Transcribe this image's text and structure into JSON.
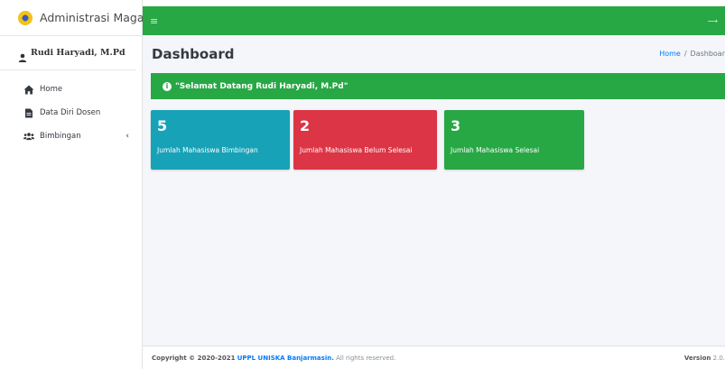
{
  "brand": {
    "title": "Administrasi Magang"
  },
  "user": {
    "name": "Rudi Haryadi, M.Pd"
  },
  "sidebar": {
    "items": [
      {
        "label": "Home",
        "icon": "home-icon"
      },
      {
        "label": "Data Diri Dosen",
        "icon": "file-icon"
      },
      {
        "label": "Bimbingan",
        "icon": "users-icon",
        "chevron": "‹"
      }
    ]
  },
  "topbar": {
    "menu_glyph": "≡",
    "logout_glyph": "⟶"
  },
  "header": {
    "title": "Dashboard",
    "breadcrumb": {
      "home": "Home",
      "sep": "/",
      "current": "Dashboar"
    }
  },
  "alert": {
    "text": "\"Selamat Datang Rudi Haryadi, M.Pd\""
  },
  "stats": [
    {
      "value": "5",
      "label": "Jumlah Mahasiswa Bimbingan",
      "color": "#17a2b8"
    },
    {
      "value": "2",
      "label": "Jumlah Mahasiswa Belum Selesai",
      "color": "#dc3545"
    },
    {
      "value": "3",
      "label": "Jumlah Mahasiswa Selesai",
      "color": "#28a745"
    }
  ],
  "footer": {
    "copyright": "Copyright © 2020-2021",
    "org": "UPPL UNISKA Banjarmasin.",
    "rights": "All rights reserved.",
    "version_label": "Version",
    "version_value": "2.0."
  },
  "colors": {
    "accent": "#28a745",
    "info": "#17a2b8",
    "danger": "#dc3545",
    "link": "#007bff"
  }
}
